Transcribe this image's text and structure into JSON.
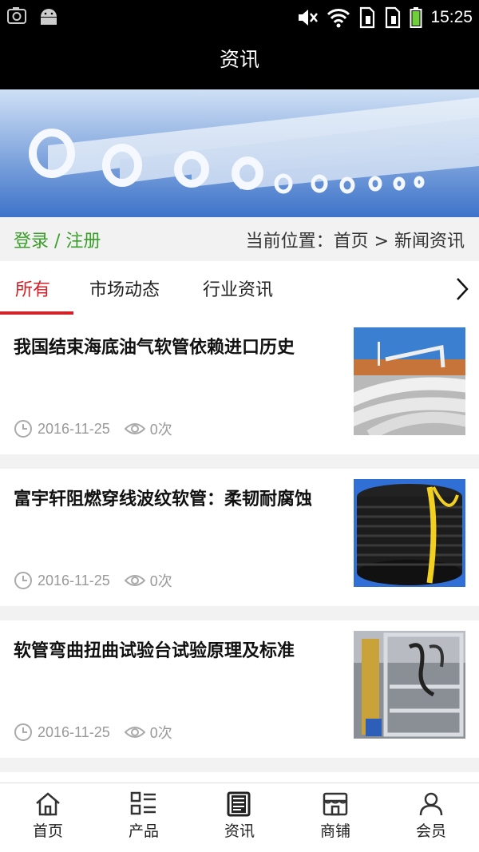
{
  "status_bar": {
    "time": "15:25",
    "icons": [
      "screenshot-icon",
      "android-icon",
      "mute-icon",
      "wifi-icon",
      "sim-1-icon",
      "sim-2-icon",
      "battery-icon"
    ]
  },
  "header": {
    "title": "资讯"
  },
  "auth": {
    "login": "登录",
    "separator": " / ",
    "register": "注册"
  },
  "breadcrumb": {
    "text": "当前位置：首页 > 新闻资讯"
  },
  "tabs": [
    {
      "label": "所有",
      "active": true
    },
    {
      "label": "市场动态",
      "active": false
    },
    {
      "label": "行业资讯",
      "active": false
    }
  ],
  "news": [
    {
      "title": "我国结束海底油气软管依赖进口历史",
      "date": "2016-11-25",
      "views": "0次"
    },
    {
      "title": "富宇轩阻燃穿线波纹软管：柔韧耐腐蚀",
      "date": "2016-11-25",
      "views": "0次"
    },
    {
      "title": "软管弯曲扭曲试验台试验原理及标准",
      "date": "2016-11-25",
      "views": "0次"
    }
  ],
  "bottom_nav": [
    {
      "label": "首页",
      "icon": "home-icon"
    },
    {
      "label": "产品",
      "icon": "grid-list-icon"
    },
    {
      "label": "资讯",
      "icon": "news-icon"
    },
    {
      "label": "商铺",
      "icon": "shop-icon"
    },
    {
      "label": "会员",
      "icon": "user-icon"
    }
  ],
  "colors": {
    "accent": "#d4222a",
    "auth_green": "#3a9e2a",
    "header_bg": "#000000"
  }
}
